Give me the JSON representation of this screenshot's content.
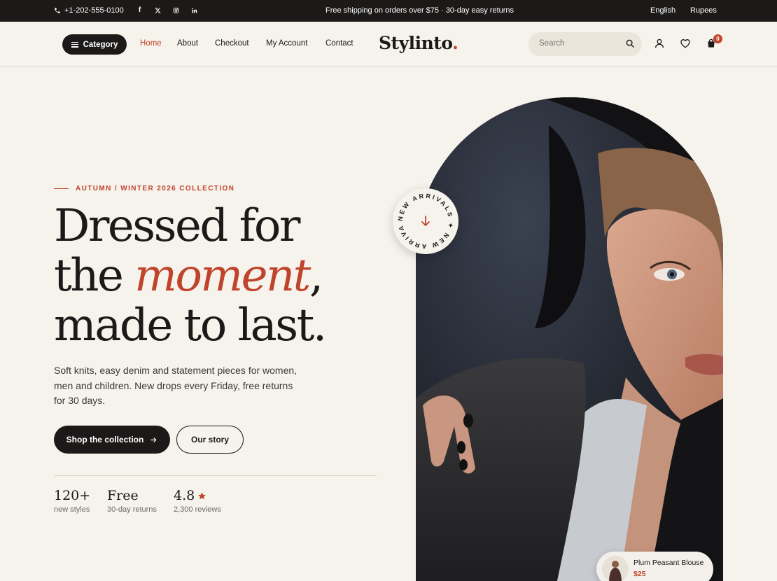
{
  "topbar": {
    "phone": "+1-202-555-0100",
    "socials": [
      "facebook-icon",
      "x-icon",
      "instagram-icon",
      "linkedin-icon"
    ],
    "promo": "Free shipping on orders over $75  ·  30-day easy returns",
    "language": "English",
    "currency": "Rupees"
  },
  "header": {
    "category_label": "Category",
    "nav": [
      {
        "label": "Home",
        "active": true
      },
      {
        "label": "About"
      },
      {
        "label": "Checkout"
      },
      {
        "label": "My Account"
      },
      {
        "label": "Contact"
      }
    ],
    "logo": "Stylinto",
    "logo_dot": ".",
    "search_placeholder": "Search",
    "cart_count": "0"
  },
  "hero": {
    "eyebrow": "AUTUMN / WINTER 2026 COLLECTION",
    "headline_line1": "Dressed for",
    "headline_line2_pre": "the ",
    "headline_accent": "moment",
    "headline_line2_post": ",",
    "headline_line3": "made to last.",
    "description": "Soft knits, easy denim and statement pieces for women, men and children. New drops every Friday, free returns for 30 days.",
    "primary_cta": "Shop the collection",
    "secondary_cta": "Our story",
    "badge_text": "NEW ARRIVALS ✦ NEW ARRIVALS ✦ "
  },
  "stats": [
    {
      "value": "120+",
      "label": "new styles"
    },
    {
      "value": "Free",
      "label": "30-day returns"
    },
    {
      "value": "4.8",
      "label": "2,300 reviews"
    }
  ],
  "product": {
    "name": "Plum Peasant Blouse",
    "price": "$25"
  },
  "colors": {
    "accent": "#c0432b",
    "dark": "#1c1a19",
    "background": "#f6f2ec"
  }
}
